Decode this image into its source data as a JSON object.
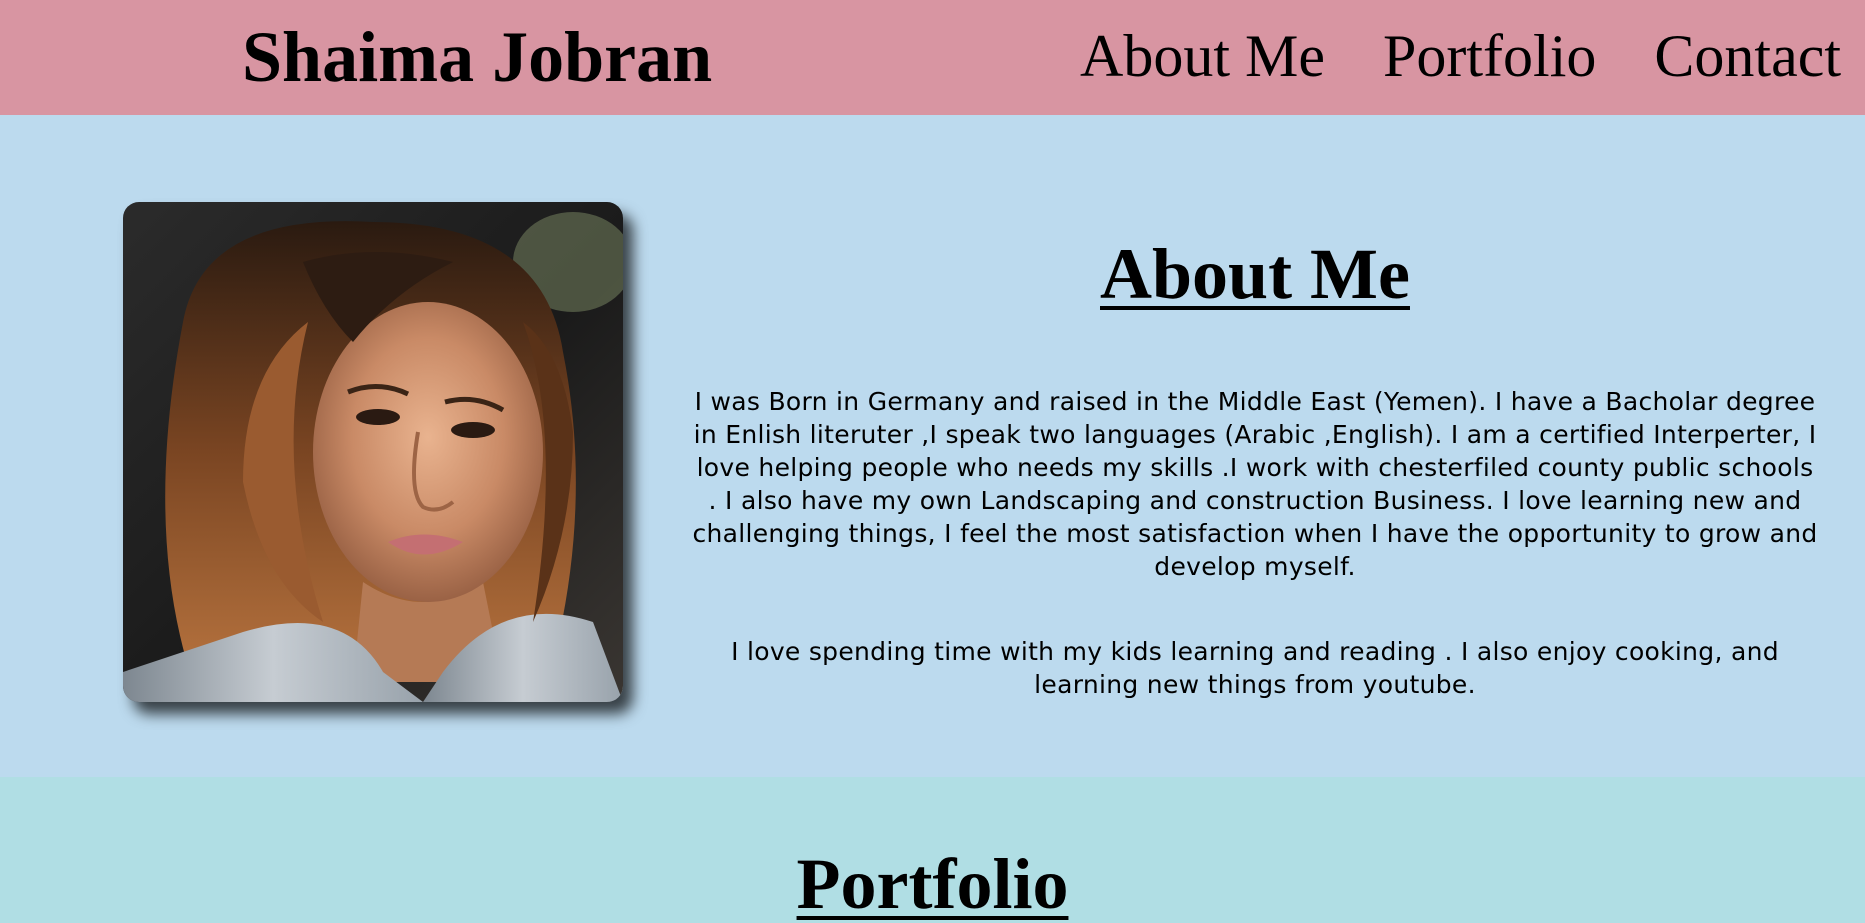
{
  "header": {
    "site_title": "Shaima Jobran",
    "nav": [
      {
        "label": "About Me"
      },
      {
        "label": "Portfolio"
      },
      {
        "label": "Contact"
      }
    ]
  },
  "about": {
    "photo_alt": "Portrait photo of Shaima Jobran",
    "heading": "About Me",
    "paragraph_1": "I was Born in Germany and raised in the Middle East (Yemen). I have a Bacholar degree in Enlish literuter ,I speak two languages (Arabic ,English). I am a certified Interperter, I love helping people who needs my skills .I work with chesterfiled county public schools . I also have my own Landscaping and construction Business. I love learning new and challenging things, I feel the most satisfaction when I have the opportunity to grow and develop myself.",
    "paragraph_2": "I love spending time with my kids learning and reading . I also enjoy cooking, and learning new things from youtube."
  },
  "portfolio": {
    "heading": "Portfolio"
  },
  "colors": {
    "header_bg": "#d895a2",
    "about_bg": "#bcdaee",
    "portfolio_bg": "#b0dee4"
  }
}
